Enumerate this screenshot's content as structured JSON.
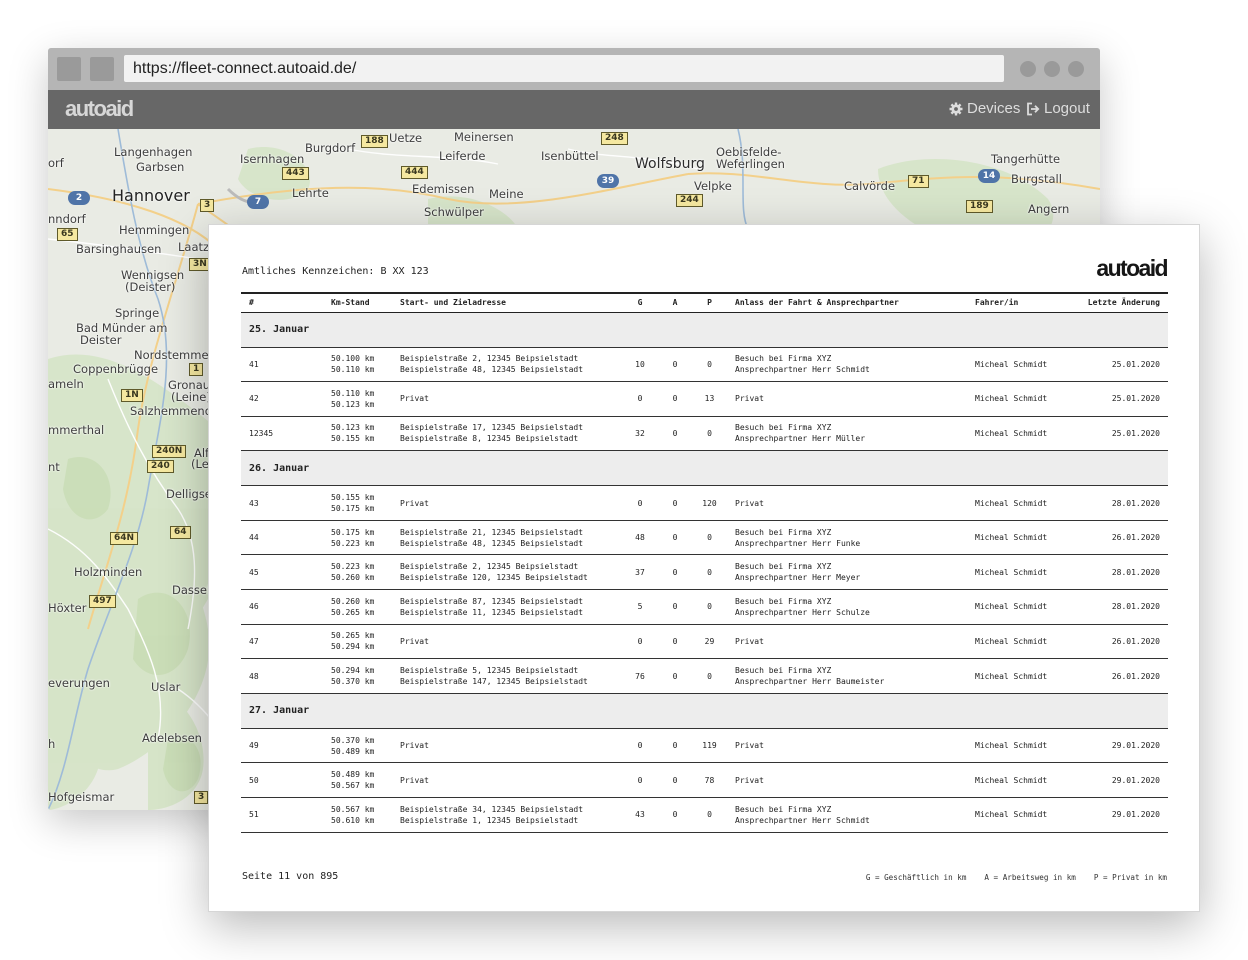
{
  "browser": {
    "url": "https://fleet-connect.autoaid.de/",
    "brand": "autoaid",
    "nav": {
      "devices": "Devices",
      "logout": "Logout"
    }
  },
  "map": {
    "places": [
      {
        "name": "Langenhagen",
        "class": ""
      },
      {
        "name": "Garbsen",
        "class": ""
      },
      {
        "name": "Isernhagen",
        "class": ""
      },
      {
        "name": "Burgdorf",
        "class": ""
      },
      {
        "name": "Uetze",
        "class": ""
      },
      {
        "name": "Meinersen",
        "class": ""
      },
      {
        "name": "Leiferde",
        "class": ""
      },
      {
        "name": "Isenbüttel",
        "class": ""
      },
      {
        "name": "Wolfsburg",
        "class": "mid"
      },
      {
        "name": "Oebisfelde-",
        "class": ""
      },
      {
        "name": "Weferlingen",
        "class": ""
      },
      {
        "name": "Tangerhütte",
        "class": ""
      },
      {
        "name": "Burgstall",
        "class": ""
      },
      {
        "name": "Hannover",
        "class": "big"
      },
      {
        "name": "Lehrte",
        "class": ""
      },
      {
        "name": "Edemissen",
        "class": ""
      },
      {
        "name": "Meine",
        "class": ""
      },
      {
        "name": "Velpke",
        "class": ""
      },
      {
        "name": "Calvörde",
        "class": ""
      },
      {
        "name": "Angern",
        "class": ""
      },
      {
        "name": "Schwülper",
        "class": ""
      },
      {
        "name": "orf",
        "class": ""
      },
      {
        "name": "nndorf",
        "class": ""
      },
      {
        "name": "Hemmingen",
        "class": ""
      },
      {
        "name": "Barsinghausen",
        "class": ""
      },
      {
        "name": "Laatz",
        "class": ""
      },
      {
        "name": "Wennigsen",
        "class": ""
      },
      {
        "name": "(Deister)",
        "class": ""
      },
      {
        "name": "Springe",
        "class": ""
      },
      {
        "name": "Bad Münder am",
        "class": ""
      },
      {
        "name": "Deister",
        "class": ""
      },
      {
        "name": "Nordstemmen",
        "class": ""
      },
      {
        "name": "Coppenbrügge",
        "class": ""
      },
      {
        "name": "ameln",
        "class": ""
      },
      {
        "name": "Gronau",
        "class": ""
      },
      {
        "name": "(Leine)",
        "class": ""
      },
      {
        "name": "Salzhemmendorf",
        "class": ""
      },
      {
        "name": "mmerthal",
        "class": ""
      },
      {
        "name": "Alf",
        "class": ""
      },
      {
        "name": "(Lei",
        "class": ""
      },
      {
        "name": "nt",
        "class": ""
      },
      {
        "name": "Delligsen",
        "class": ""
      },
      {
        "name": "Holzminden",
        "class": ""
      },
      {
        "name": "Dassel",
        "class": ""
      },
      {
        "name": "Höxter",
        "class": ""
      },
      {
        "name": "everungen",
        "class": ""
      },
      {
        "name": "Uslar",
        "class": ""
      },
      {
        "name": "Adelebsen",
        "class": ""
      },
      {
        "name": "h",
        "class": ""
      },
      {
        "name": "Hofgeismar",
        "class": ""
      }
    ],
    "road_shields": [
      "188",
      "248",
      "443",
      "444",
      "3",
      "244",
      "71",
      "189",
      "65",
      "3N",
      "1",
      "1N",
      "240N",
      "240",
      "64N",
      "64",
      "497",
      "3"
    ],
    "autobahn_shields": [
      "2",
      "7",
      "39",
      "14"
    ]
  },
  "report": {
    "plate_label": "Amtliches Kennzeichen: B XX 123",
    "logo": "autoaid",
    "columns": [
      "#",
      "Km-Stand",
      "Start- und Zieladresse",
      "G",
      "A",
      "P",
      "Anlass der Fahrt & Ansprechpartner",
      "Fahrer/in",
      "Letzte Änderung"
    ],
    "groups": [
      {
        "date": "25. Januar",
        "trips": [
          {
            "id": "41",
            "km_start": "50.100 km",
            "km_end": "50.110 km",
            "addr_start": "Beispielstraße 2, 12345 Beipsielstadt",
            "addr_end": "Beispielstraße 48, 12345 Beipsielstadt",
            "g": "10",
            "a": "0",
            "p": "0",
            "purpose": "Besuch bei Firma XYZ",
            "contact": "Ansprechpartner Herr Schmidt",
            "driver": "Micheal Schmidt",
            "changed": "25.01.2020"
          },
          {
            "id": "42",
            "km_start": "50.110 km",
            "km_end": "50.123 km",
            "addr_start": "Privat",
            "addr_end": "",
            "g": "0",
            "a": "0",
            "p": "13",
            "purpose": "Privat",
            "contact": "",
            "driver": "Micheal Schmidt",
            "changed": "25.01.2020"
          },
          {
            "id": "12345",
            "km_start": "50.123 km",
            "km_end": "50.155 km",
            "addr_start": "Beispielstraße 17, 12345 Beipsielstadt",
            "addr_end": "Beispielstraße 8, 12345 Beipsielstadt",
            "g": "32",
            "a": "0",
            "p": "0",
            "purpose": "Besuch bei Firma XYZ",
            "contact": "Ansprechpartner Herr Müller",
            "driver": "Micheal Schmidt",
            "changed": "25.01.2020"
          }
        ]
      },
      {
        "date": "26. Januar",
        "trips": [
          {
            "id": "43",
            "km_start": "50.155 km",
            "km_end": "50.175 km",
            "addr_start": "Privat",
            "addr_end": "",
            "g": "0",
            "a": "0",
            "p": "120",
            "purpose": "Privat",
            "contact": "",
            "driver": "Micheal Schmidt",
            "changed": "28.01.2020"
          },
          {
            "id": "44",
            "km_start": "50.175 km",
            "km_end": "50.223 km",
            "addr_start": "Beispielstraße 21, 12345 Beipsielstadt",
            "addr_end": "Beispielstraße 48, 12345 Beipsielstadt",
            "g": "48",
            "a": "0",
            "p": "0",
            "purpose": "Besuch bei Firma XYZ",
            "contact": "Ansprechpartner Herr Funke",
            "driver": "Micheal Schmidt",
            "changed": "26.01.2020"
          },
          {
            "id": "45",
            "km_start": "50.223 km",
            "km_end": "50.260 km",
            "addr_start": "Beispielstraße 2, 12345 Beipsielstadt",
            "addr_end": "Beispielstraße 120, 12345 Beipsielstadt",
            "g": "37",
            "a": "0",
            "p": "0",
            "purpose": "Besuch bei Firma XYZ",
            "contact": "Ansprechpartner Herr Meyer",
            "driver": "Micheal Schmidt",
            "changed": "28.01.2020"
          },
          {
            "id": "46",
            "km_start": "50.260 km",
            "km_end": "50.265 km",
            "addr_start": "Beispielstraße 87, 12345 Beipsielstadt",
            "addr_end": "Beispielstraße 11, 12345 Beipsielstadt",
            "g": "5",
            "a": "0",
            "p": "0",
            "purpose": "Besuch bei Firma XYZ",
            "contact": "Ansprechpartner Herr Schulze",
            "driver": "Micheal Schmidt",
            "changed": "28.01.2020"
          },
          {
            "id": "47",
            "km_start": "50.265 km",
            "km_end": "50.294 km",
            "addr_start": "Privat",
            "addr_end": "",
            "g": "0",
            "a": "0",
            "p": "29",
            "purpose": "Privat",
            "contact": "",
            "driver": "Micheal Schmidt",
            "changed": "26.01.2020"
          },
          {
            "id": "48",
            "km_start": "50.294 km",
            "km_end": "50.370 km",
            "addr_start": "Beispielstraße 5, 12345 Beipsielstadt",
            "addr_end": "Beispielstraße 147, 12345 Beipsielstadt",
            "g": "76",
            "a": "0",
            "p": "0",
            "purpose": "Besuch bei Firma XYZ",
            "contact": "Ansprechpartner Herr Baumeister",
            "driver": "Micheal Schmidt",
            "changed": "26.01.2020"
          }
        ]
      },
      {
        "date": "27. Januar",
        "trips": [
          {
            "id": "49",
            "km_start": "50.370 km",
            "km_end": "50.489 km",
            "addr_start": "Privat",
            "addr_end": "",
            "g": "0",
            "a": "0",
            "p": "119",
            "purpose": "Privat",
            "contact": "",
            "driver": "Micheal Schmidt",
            "changed": "29.01.2020"
          },
          {
            "id": "50",
            "km_start": "50.489 km",
            "km_end": "50.567 km",
            "addr_start": "Privat",
            "addr_end": "",
            "g": "0",
            "a": "0",
            "p": "78",
            "purpose": "Privat",
            "contact": "",
            "driver": "Micheal Schmidt",
            "changed": "29.01.2020"
          },
          {
            "id": "51",
            "km_start": "50.567 km",
            "km_end": "50.610 km",
            "addr_start": "Beispielstraße 34, 12345 Beipsielstadt",
            "addr_end": "Beispielstraße 1, 12345 Beipsielstadt",
            "g": "43",
            "a": "0",
            "p": "0",
            "purpose": "Besuch bei Firma XYZ",
            "contact": "Ansprechpartner Herr Schmidt",
            "driver": "Micheal Schmidt",
            "changed": "29.01.2020"
          }
        ]
      }
    ],
    "page_label": "Seite 11 von 895",
    "legend": [
      "G = Geschäftlich in km",
      "A = Arbeitsweg in km",
      "P = Privat in km"
    ]
  }
}
